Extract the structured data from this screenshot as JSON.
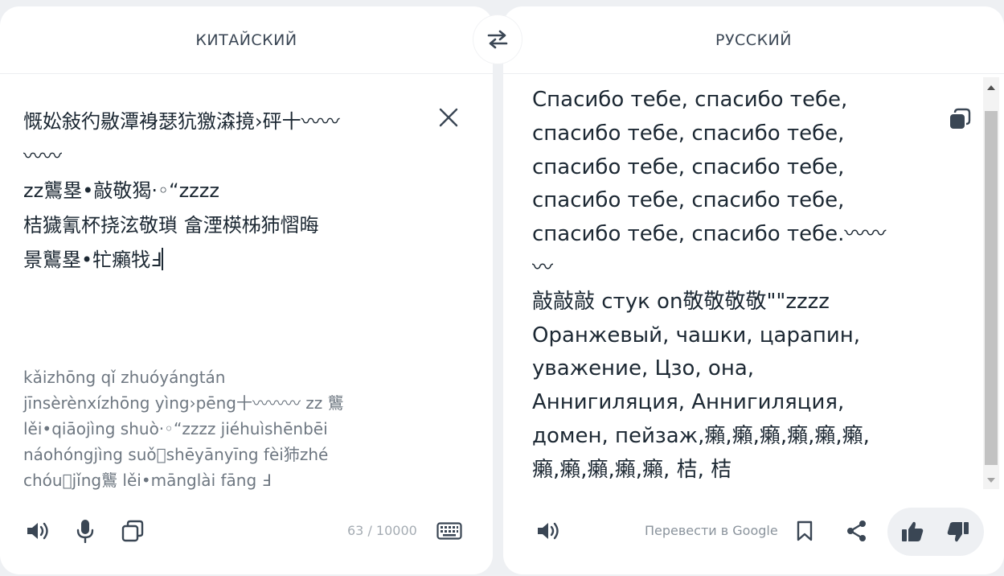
{
  "source": {
    "language": "КИТАЙСКИЙ",
    "text_lines": [
      "慨妐敍彴敭潭裑瑟犺獥潹摬›砰十〰〰",
      "〰〰",
      "zz鸗塁•敲敬猲·◦“zzzz",
      "桔獩氰杯挠泫敬瑣 畣湮楧柹犻慴晦",
      "景鸗塁•牤癩牫Ⅎ"
    ],
    "transliteration_lines": [
      "kǎizhōng qǐ zhuóyángtán",
      "jīnsèrènxízhōng yìng›pēng十〰〰〰 zz 鸗",
      "lěi•qiāojìng shuò·◦“zzzz jiéhuìshēnbēi",
      "náohóngjìng suǒ⃞shēyānyīng fèi犻zhé",
      "chóu⃞jǐng鸗 lěi•mānglài fāng Ⅎ"
    ],
    "char_count": "63 / 10000"
  },
  "target": {
    "language": "РУССКИЙ",
    "text_lines": [
      "Спасибо тебе, спасибо тебе,",
      "спасибо тебе, спасибо тебе,",
      "спасибо тебе, спасибо тебе,",
      "спасибо тебе, спасибо тебе,",
      "спасибо тебе, спасибо тебе.〰〰",
      "〰",
      "敲敲敲 стук on敬敬敬敬\"\"zzzz",
      "Оранжевый, чашки, царапин,",
      "уважение, Цзо, она,",
      "Аннигиляция, Аннигиляция,",
      "домен, пейзаж,癩,癩,癩,癩,癩,癩,",
      "癩,癩,癩,癩,癩, 桔, 桔"
    ],
    "google_link": "Перевести в Google"
  },
  "icons": {
    "swap": "swap-arrows-icon",
    "clear": "close-icon",
    "speak": "speaker-icon",
    "mic": "microphone-icon",
    "copy": "copy-icon",
    "keyboard": "keyboard-icon",
    "bookmark": "bookmark-icon",
    "share": "share-icon",
    "like": "thumbs-up-icon",
    "dislike": "thumbs-down-icon"
  },
  "colors": {
    "background": "#eef0f3",
    "panel": "#ffffff",
    "text": "#1c2833",
    "muted": "#6e7781",
    "icon": "#3a4654"
  }
}
